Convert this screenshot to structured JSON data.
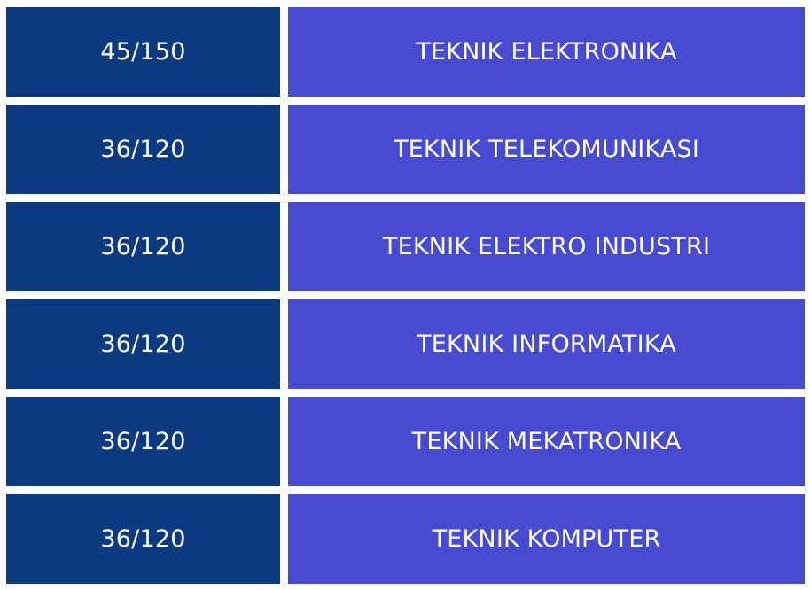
{
  "rows": [
    {
      "quota": "45/150",
      "program": "TEKNIK ELEKTRONIKA"
    },
    {
      "quota": "36/120",
      "program": "TEKNIK TELEKOMUNIKASI"
    },
    {
      "quota": "36/120",
      "program": "TEKNIK ELEKTRO INDUSTRI"
    },
    {
      "quota": "36/120",
      "program": "TEKNIK INFORMATIKA"
    },
    {
      "quota": "36/120",
      "program": "TEKNIK MEKATRONIKA"
    },
    {
      "quota": "36/120",
      "program": "TEKNIK KOMPUTER"
    }
  ],
  "colors": {
    "quota_bg": "#0b3a80",
    "program_bg": "#464bd1",
    "text": "#ffffff"
  }
}
